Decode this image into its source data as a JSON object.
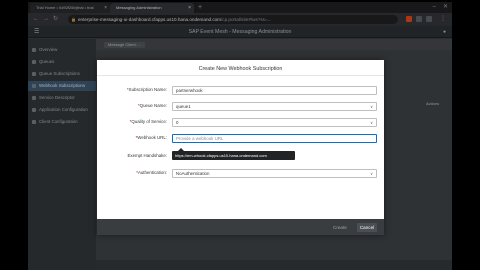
{
  "browser": {
    "tabs": [
      {
        "label": "Trial Home • 0d92f26b(trial • trial",
        "active": false
      },
      {
        "label": "Messaging Administration",
        "active": true
      }
    ],
    "new_tab_icon": "plus-icon",
    "url_host": "enterprise-messaging-ui-dashboard.cfapps.us10.hana.ondemand.com",
    "url_path": "/cp.portal/site#/ws?ss=...",
    "win_min": "–",
    "win_close": "✕"
  },
  "shell": {
    "title": "SAP Event Mesh - Messaging Administration",
    "menu_icon": "hamburger-icon",
    "right_icon": "account-icon"
  },
  "sidebar": {
    "items": [
      {
        "label": "Overview",
        "active": false
      },
      {
        "label": "Queues",
        "active": false
      },
      {
        "label": "Queue Subscriptions",
        "active": false
      },
      {
        "label": "Webhook Subscriptions",
        "active": true
      },
      {
        "label": "Service Descriptor",
        "active": false
      },
      {
        "label": "Application Configuration",
        "active": false
      },
      {
        "label": "Client Configuration",
        "active": false
      }
    ]
  },
  "content": {
    "breadcrumb": "Message Client: ...",
    "bg_label": "Actions"
  },
  "dialog": {
    "title": "Create New Webhook Subscription",
    "fields": [
      {
        "label": "Subscription Name:",
        "required": true,
        "value": "partnerwhook",
        "placeholder": "",
        "type": "text"
      },
      {
        "label": "Queue Name:",
        "required": true,
        "value": "queue1",
        "placeholder": "",
        "type": "select"
      },
      {
        "label": "Quality of Service:",
        "required": true,
        "value": "0",
        "placeholder": "",
        "type": "select"
      },
      {
        "label": "Webhook URL:",
        "required": true,
        "value": "",
        "placeholder": "Provide a webhook URL",
        "type": "text"
      },
      {
        "label": "Exempt Handshake:",
        "required": false,
        "value": "",
        "placeholder": "",
        "type": "select"
      },
      {
        "label": "Authentication:",
        "required": true,
        "value": "NoAuthentication",
        "placeholder": "",
        "type": "select"
      }
    ],
    "tooltip": "https://em-whook.cfapps.us10.hana.ondemand.com",
    "create_label": "Create",
    "cancel_label": "Cancel"
  },
  "colors": {
    "accent": "#0a6ed1",
    "dialog_bg": "#ffffff",
    "shell_bg": "#2c3034",
    "required": "#bb0000"
  }
}
